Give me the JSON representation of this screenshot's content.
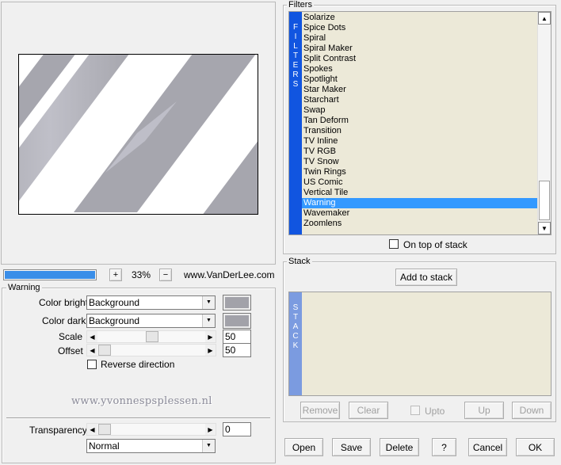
{
  "preview": {
    "zoom": "33%",
    "zoom_in": "+",
    "zoom_out": "−",
    "website": "www.VanDerLee.com"
  },
  "effect": {
    "title": "Warning",
    "color_bright": {
      "label": "Color bright",
      "value": "Background",
      "color": "#a2a2a9"
    },
    "color_dark": {
      "label": "Color dark",
      "value": "Background",
      "color": "#a2a2a9"
    },
    "scale": {
      "label": "Scale",
      "value": "50",
      "position": 0.5
    },
    "offset": {
      "label": "Offset",
      "value": "50",
      "position": 0.1
    },
    "reverse_label": "Reverse direction",
    "watermark": "www.yvonnespsplessen.nl",
    "transparency": {
      "label": "Transparency",
      "value": "0",
      "position": 0.0
    },
    "blend_mode": "Normal"
  },
  "filters": {
    "title": "Filters",
    "vertical_label": "FILTERS",
    "items": [
      "Solarize",
      "Spice Dots",
      "Spiral",
      "Spiral Maker",
      "Split Contrast",
      "Spokes",
      "Spotlight",
      "Star Maker",
      "Starchart",
      "Swap",
      "Tan Deform",
      "Transition",
      "TV Inline",
      "TV RGB",
      "TV Snow",
      "Twin Rings",
      "US Comic",
      "Vertical Tile",
      "Warning",
      "Wavemaker",
      "Zoomlens"
    ],
    "selected": "Warning",
    "on_top_label": "On top of stack"
  },
  "stack": {
    "title": "Stack",
    "vertical_label": "STACK",
    "add_label": "Add to stack",
    "remove_label": "Remove",
    "clear_label": "Clear",
    "upto_label": "Upto",
    "up_label": "Up",
    "down_label": "Down"
  },
  "footer": {
    "open": "Open",
    "save": "Save",
    "delete": "Delete",
    "help": "?",
    "cancel": "Cancel",
    "ok": "OK"
  },
  "colors": {
    "accent_blue": "#1155e0",
    "selection": "#3399ff",
    "list_bg": "#ece9d8",
    "stack_bar": "#7b9be0"
  }
}
